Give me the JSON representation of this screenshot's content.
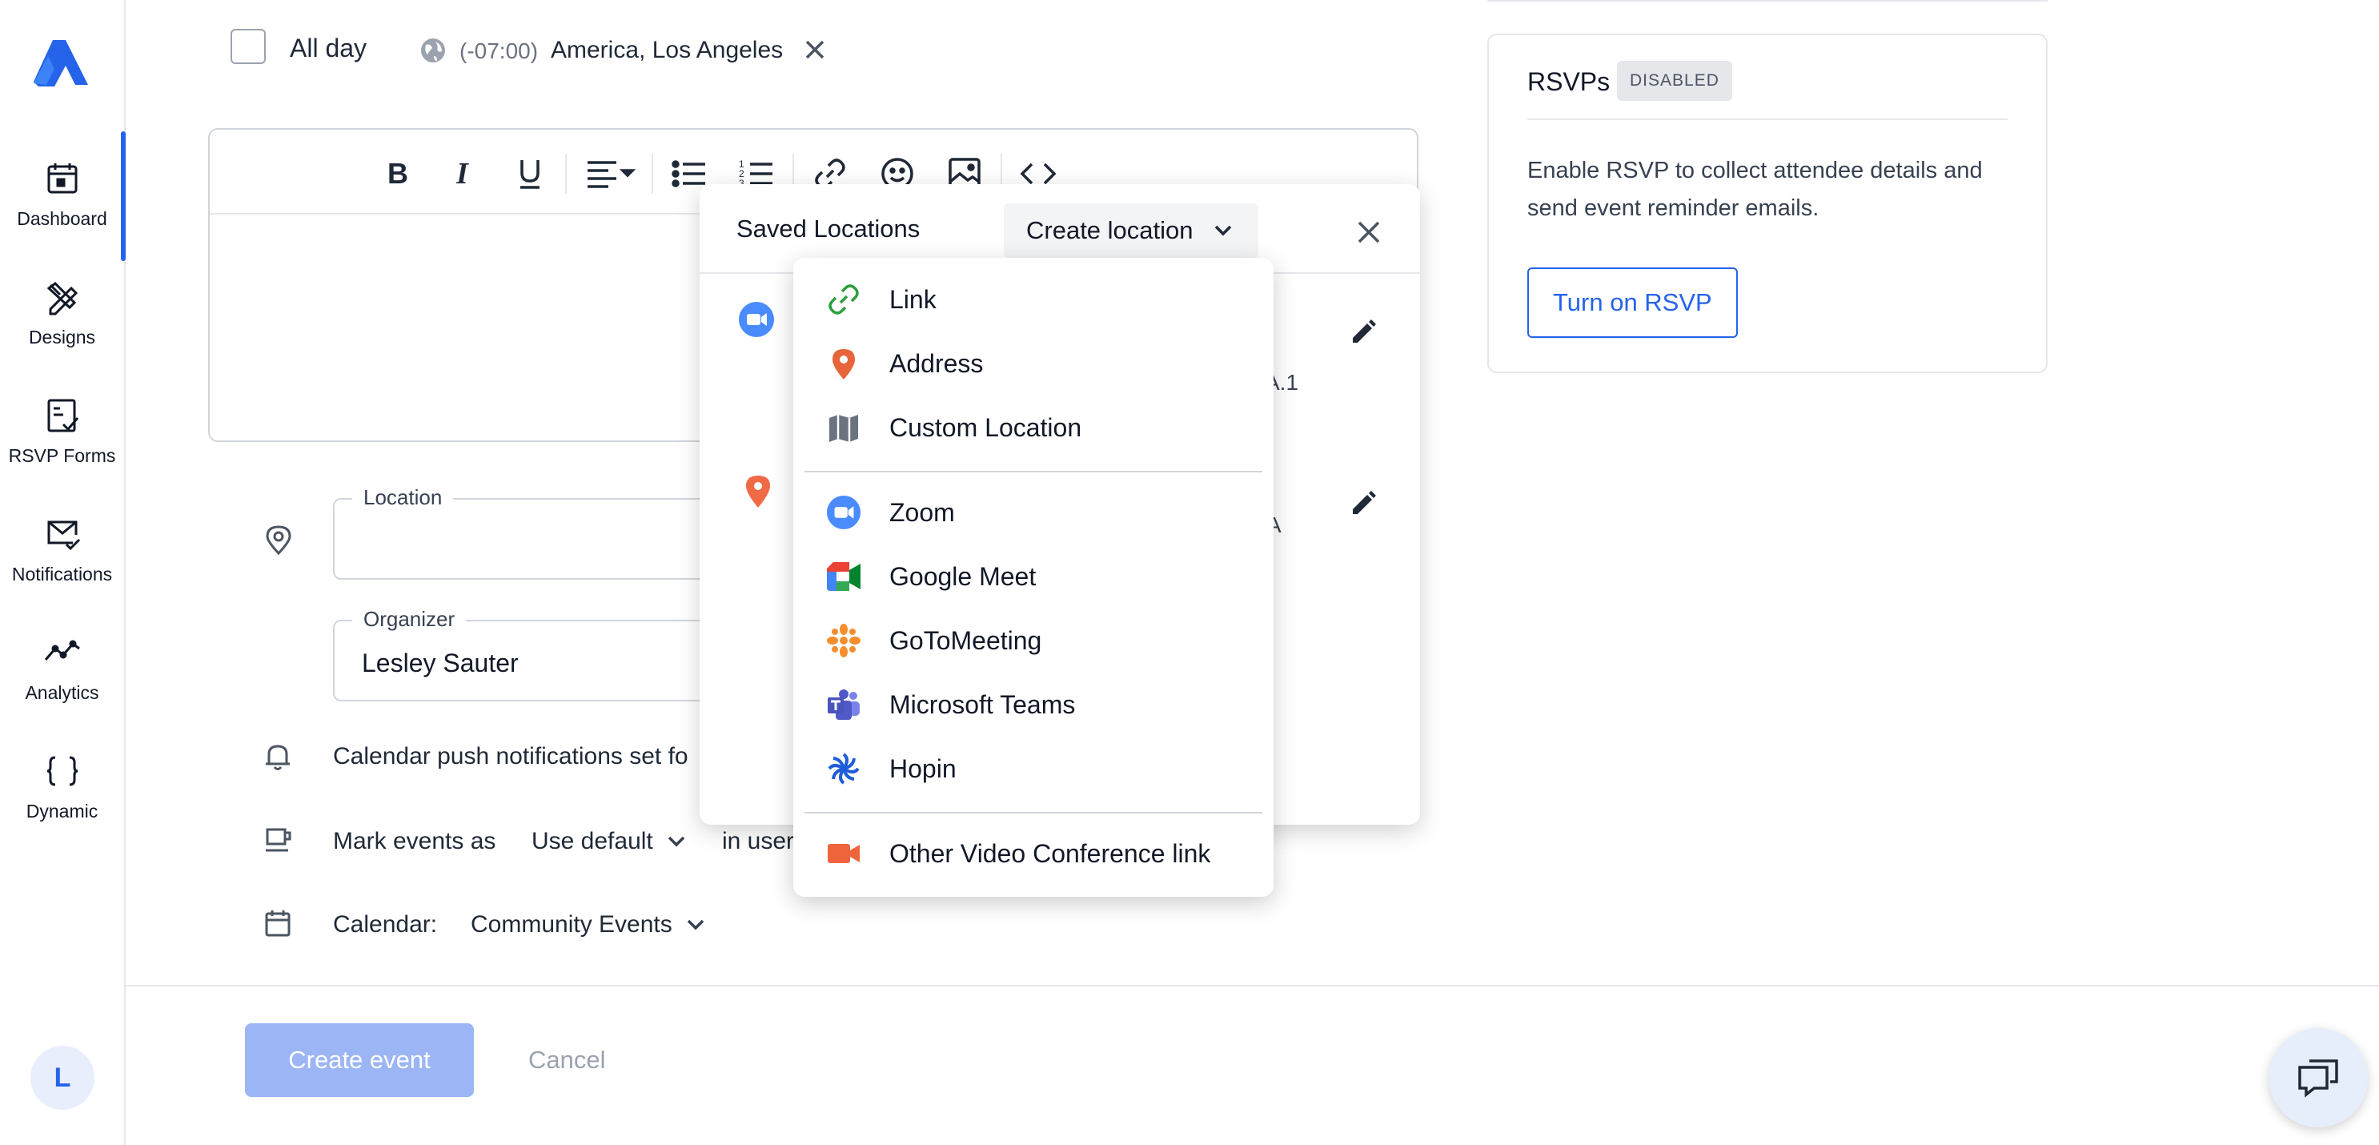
{
  "sidebar": {
    "items": [
      {
        "label": "Dashboard",
        "icon": "calendar-icon",
        "active": true
      },
      {
        "label": "Designs",
        "icon": "pencil-ruler-icon"
      },
      {
        "label": "RSVP Forms",
        "icon": "form-check-icon"
      },
      {
        "label": "Notifications",
        "icon": "mail-check-icon"
      },
      {
        "label": "Analytics",
        "icon": "line-chart-icon"
      },
      {
        "label": "Dynamic",
        "icon": "braces-icon"
      }
    ],
    "avatar_initial": "L",
    "accent_color": "#2563eb"
  },
  "datetime": {
    "allday_label": "All day",
    "allday_checked": false,
    "tz_offset": "(-07:00)",
    "tz_name": "America, Los Angeles"
  },
  "form": {
    "location_label": "Location",
    "location_value": "",
    "organizer_label": "Organizer",
    "organizer_value": "Lesley Sauter",
    "push_notif_text": "Calendar push notifications set fo",
    "mark_events_label": "Mark events as",
    "mark_events_value": "Use default",
    "mark_events_suffix": "in user",
    "calendar_label": "Calendar:",
    "calendar_value": "Community Events"
  },
  "actions": {
    "create_label": "Create event",
    "cancel_label": "Cancel"
  },
  "rsvp": {
    "title": "RSVPs",
    "badge": "DISABLED",
    "description": "Enable RSVP to collect attendee details and send event reminder emails.",
    "button_label": "Turn on RSVP"
  },
  "saved_locations": {
    "title": "Saved Locations",
    "create_label": "Create location",
    "entries": [
      {
        "icon": "zoom-icon",
        "fragment": "A.1"
      },
      {
        "icon": "map-pin-icon",
        "fragment": "A"
      }
    ]
  },
  "create_menu": {
    "groups": [
      [
        {
          "label": "Link",
          "icon": "link-icon"
        },
        {
          "label": "Address",
          "icon": "map-pin-icon"
        },
        {
          "label": "Custom Location",
          "icon": "map-icon"
        }
      ],
      [
        {
          "label": "Zoom",
          "icon": "zoom-icon"
        },
        {
          "label": "Google Meet",
          "icon": "google-meet-icon"
        },
        {
          "label": "GoToMeeting",
          "icon": "gotomeeting-icon"
        },
        {
          "label": "Microsoft Teams",
          "icon": "microsoft-teams-icon"
        },
        {
          "label": "Hopin",
          "icon": "hopin-icon"
        }
      ],
      [
        {
          "label": "Other Video Conference link",
          "icon": "video-camera-icon"
        }
      ]
    ]
  }
}
